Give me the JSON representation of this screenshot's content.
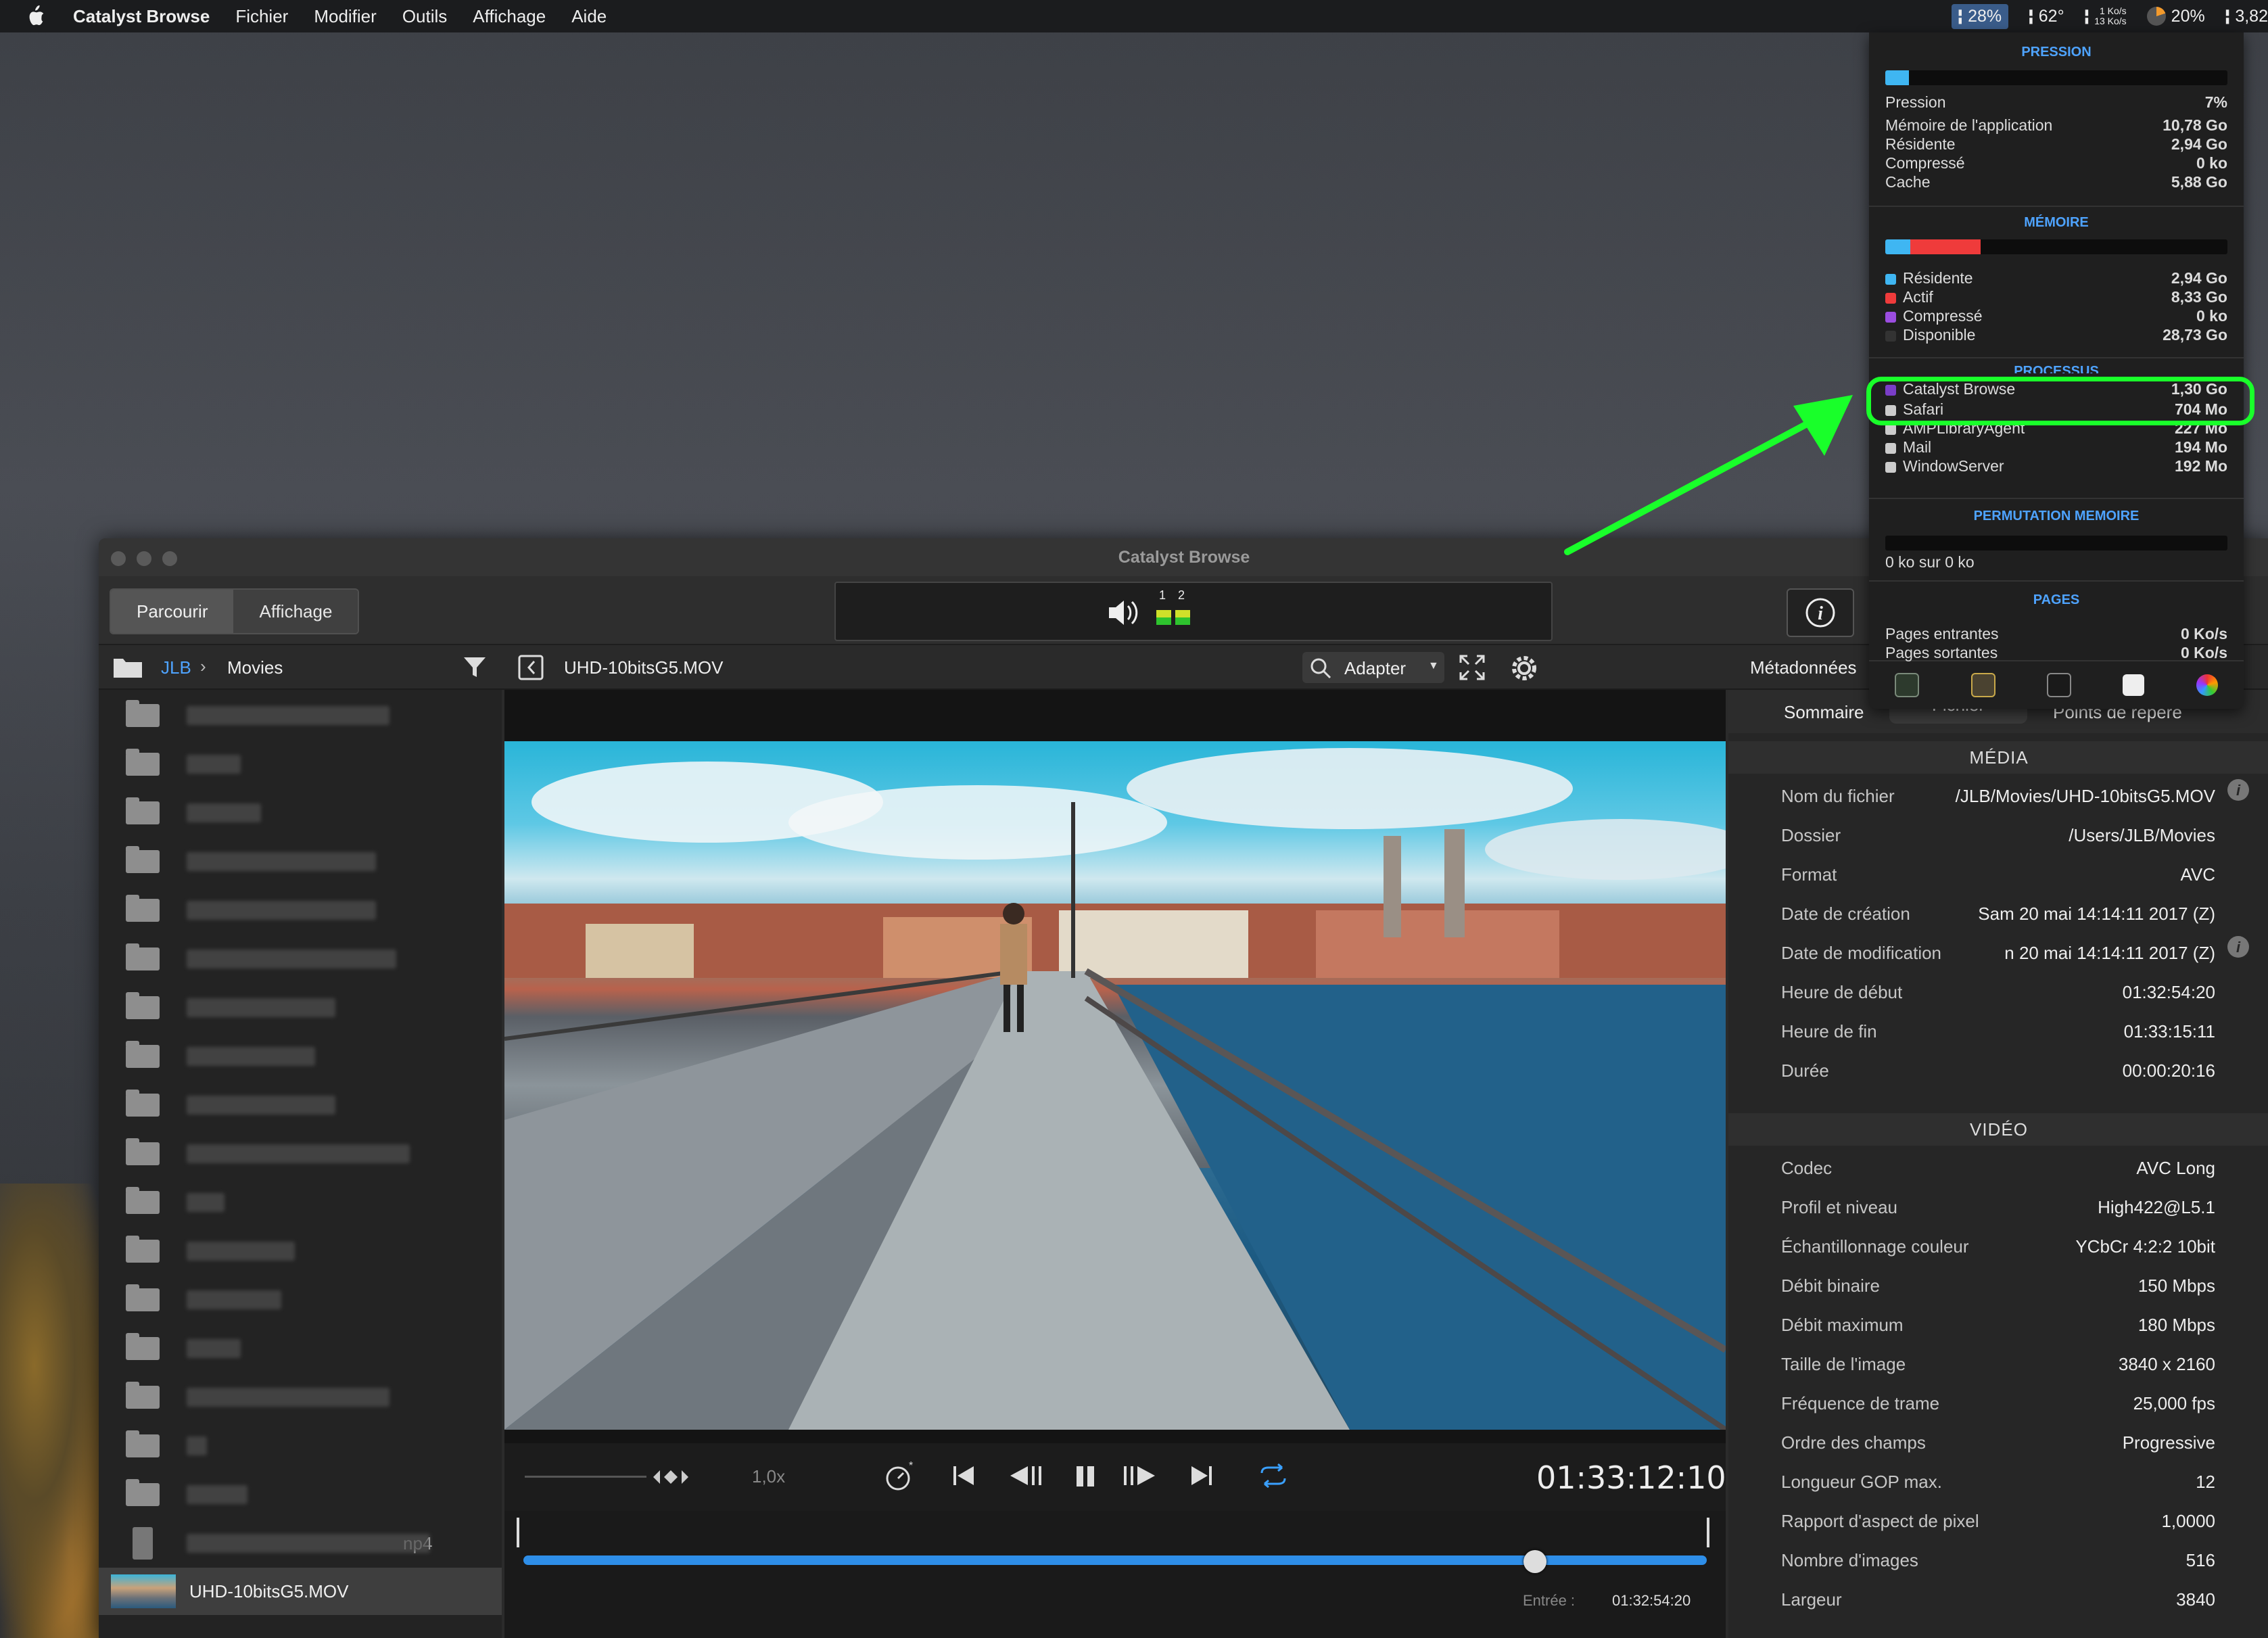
{
  "menubar": {
    "app_name": "Catalyst Browse",
    "items": [
      "Fichier",
      "Modifier",
      "Outils",
      "Affichage",
      "Aide"
    ],
    "status": {
      "cpu": "28%",
      "temp": "62°",
      "net_up": "1 Ko/s",
      "net_down": "13 Ko/s",
      "battery": "20%",
      "extra": "3,82"
    }
  },
  "window": {
    "title": "Catalyst Browse",
    "tabs": {
      "browse": "Parcourir",
      "view": "Affichage"
    },
    "audio_channels": [
      "1",
      "2"
    ]
  },
  "browser": {
    "path_root": "JLB",
    "path_current": "Movies",
    "partial_filename_suffix": "np4",
    "selected_file": "UHD-10bitsG5.MOV"
  },
  "player": {
    "filename": "UHD-10bitsG5.MOV",
    "zoom_label": "Adapter",
    "speed": "1,0x",
    "timecode": "01:33:12:10",
    "progress": 0.855,
    "entry_label": "Entrée :",
    "entry_tc": "01:32:54:20"
  },
  "metadata": {
    "header": "Métadonnées",
    "tabs": [
      "Sommaire",
      "Fichier",
      "Points de repère"
    ],
    "media_title": "MÉDIA",
    "media": [
      {
        "k": "Nom du fichier",
        "v": "/JLB/Movies/UHD-10bitsG5.MOV"
      },
      {
        "k": "Dossier",
        "v": "/Users/JLB/Movies"
      },
      {
        "k": "Format",
        "v": "AVC"
      },
      {
        "k": "Date de création",
        "v": "Sam 20 mai 14:14:11 2017 (Z)"
      },
      {
        "k": "Date de modification",
        "v": "n 20 mai 14:14:11 2017 (Z)"
      },
      {
        "k": "Heure de début",
        "v": "01:32:54:20"
      },
      {
        "k": "Heure de fin",
        "v": "01:33:15:11"
      },
      {
        "k": "Durée",
        "v": "00:00:20:16"
      }
    ],
    "video_title": "VIDÉO",
    "video": [
      {
        "k": "Codec",
        "v": "AVC Long"
      },
      {
        "k": "Profil et niveau",
        "v": "High422@L5.1"
      },
      {
        "k": "Échantillonnage couleur",
        "v": "YCbCr 4:2:2 10bit"
      },
      {
        "k": "Débit binaire",
        "v": "150 Mbps"
      },
      {
        "k": "Débit maximum",
        "v": "180 Mbps"
      },
      {
        "k": "Taille de l'image",
        "v": "3840 x 2160"
      },
      {
        "k": "Fréquence de trame",
        "v": "25,000 fps"
      },
      {
        "k": "Ordre des champs",
        "v": "Progressive"
      },
      {
        "k": "Longueur GOP max.",
        "v": "12"
      },
      {
        "k": "Rapport d'aspect de pixel",
        "v": "1,0000"
      },
      {
        "k": "Nombre d'images",
        "v": "516"
      },
      {
        "k": "Largeur",
        "v": "3840"
      }
    ]
  },
  "memory_popup": {
    "pressure_title": "PRESSION",
    "pressure_level": 0.07,
    "pressure": [
      {
        "k": "Pression",
        "v": "7%"
      },
      {
        "k": "Mémoire de l'application",
        "v": "10,78 Go"
      },
      {
        "k": "Résidente",
        "v": "2,94 Go"
      },
      {
        "k": "Compressé",
        "v": "0 ko"
      },
      {
        "k": "Cache",
        "v": "5,88 Go"
      }
    ],
    "memory_title": "MÉMOIRE",
    "memory": [
      {
        "k": "Résidente",
        "v": "2,94 Go",
        "color": "#3fb6f2"
      },
      {
        "k": "Actif",
        "v": "8,33 Go",
        "color": "#ef3b3b"
      },
      {
        "k": "Compressé",
        "v": "0 ko",
        "color": "#9b4de0"
      },
      {
        "k": "Disponible",
        "v": "28,73 Go",
        "color": "#333333"
      }
    ],
    "processes_title": "PROCESSUS",
    "processes": [
      {
        "k": "Catalyst Browse",
        "v": "1,30 Go"
      },
      {
        "k": "Safari",
        "v": "704 Mo"
      },
      {
        "k": "AMPLibraryAgent",
        "v": "227 Mo"
      },
      {
        "k": "Mail",
        "v": "194 Mo"
      },
      {
        "k": "WindowServer",
        "v": "192 Mo"
      }
    ],
    "swap_title": "PERMUTATION MEMOIRE",
    "swap_text": "0 ko sur 0 ko",
    "pages_title": "PAGES",
    "pages": [
      {
        "k": "Pages entrantes",
        "v": "0 Ko/s"
      },
      {
        "k": "Pages sortantes",
        "v": "0 Ko/s"
      }
    ]
  },
  "colors": {
    "accent": "#2e8ee8",
    "highlight": "#19ff2a"
  }
}
